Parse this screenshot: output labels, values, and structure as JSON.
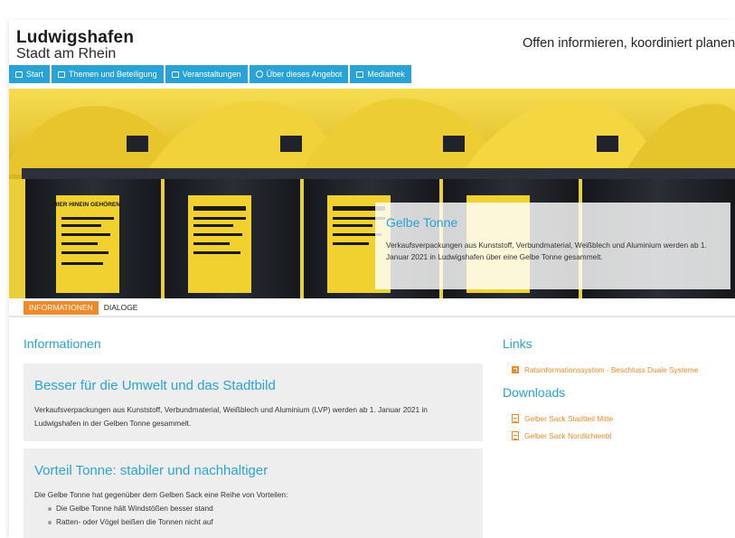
{
  "header": {
    "logo_title": "Ludwigshafen",
    "logo_subtitle": "Stadt am Rhein",
    "tagline": "Offen informieren, koordiniert planen"
  },
  "nav": {
    "items": [
      {
        "label": "Start",
        "icon": "home-icon"
      },
      {
        "label": "Themen und Beteiligung",
        "icon": "chat-icon"
      },
      {
        "label": "Veranstaltungen",
        "icon": "calendar-icon"
      },
      {
        "label": "Über dieses Angebot",
        "icon": "info-icon"
      },
      {
        "label": "Mediathek",
        "icon": "media-icon"
      }
    ]
  },
  "hero": {
    "title": "Gelbe Tonne",
    "text": "Verkaufsverpackungen aus Kunststoff, Verbundmaterial, Weißblech und Aluminium werden ab 1. Januar 2021 in Ludwigshafen über eine Gelbe Tonne gesammelt.",
    "bin_label": "HIER HINEIN GEHÖREN:"
  },
  "tabs": [
    {
      "label": "INFORMATIONEN",
      "active": true
    },
    {
      "label": "DIALOGE",
      "active": false
    }
  ],
  "main": {
    "section_title": "Informationen",
    "cards": [
      {
        "title": "Besser für die Umwelt und das Stadtbild",
        "text": "Verkaufsverpackungen aus Kunststoff, Verbundmaterial, Weißblech und Aluminium (LVP) werden ab 1. Januar 2021 in Ludwigshafen in der Gelben Tonne gesammelt."
      },
      {
        "title": "Vorteil Tonne: stabiler und nachhaltiger",
        "text": "Die Gelbe Tonne hat gegenüber dem Gelben Sack eine Reihe von Vorteilen:",
        "bullets": [
          "Die Gelbe Tonne hält Windstößen besser stand",
          "Ratten- oder Vögel beißen die Tonnen nicht auf"
        ]
      }
    ]
  },
  "sidebar": {
    "links_title": "Links",
    "links": [
      "Ratsinformationssystem - Beschluss Duale Systeme"
    ],
    "downloads_title": "Downloads",
    "downloads": [
      "Gelber Sack Stadtteil Mitte",
      "Gelber Sack Nordlichtenbl"
    ]
  },
  "colors": {
    "accent_blue": "#29a3d6",
    "accent_orange": "#f08a28",
    "bin_yellow": "#f3d23a",
    "bin_dark": "#1f2228"
  }
}
